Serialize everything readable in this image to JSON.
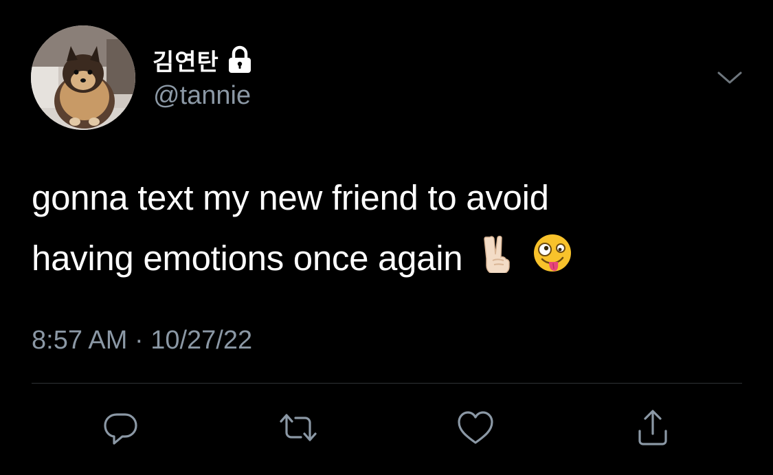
{
  "tweet": {
    "author": {
      "display_name": "김연탄",
      "handle": "@tannie",
      "protected_icon": "lock-icon",
      "avatar": "avatar-image-pomeranian"
    },
    "text_lines": [
      "gonna text my new friend to avoid",
      "having emotions once again"
    ],
    "emojis": [
      "victory-hand-emoji",
      "zany-face-emoji"
    ],
    "time": "8:57 AM",
    "separator": "·",
    "date": "10/27/22",
    "menu_icon": "chevron-down-icon",
    "actions": [
      "reply-icon",
      "retweet-icon",
      "like-icon",
      "share-icon"
    ]
  },
  "colors": {
    "background": "#000000",
    "text": "#ffffff",
    "secondary": "#8b98a5",
    "divider": "#2f3336"
  }
}
